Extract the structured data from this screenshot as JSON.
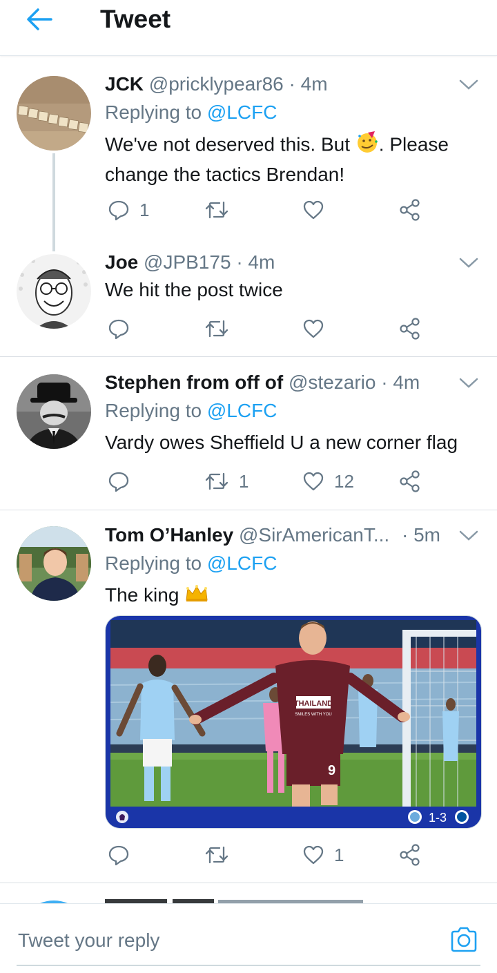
{
  "header": {
    "title": "Tweet",
    "back_icon": "arrow-left-icon"
  },
  "colors": {
    "accent": "#1da1f2",
    "secondary_text": "#657786",
    "primary_text": "#14171a",
    "card_blue": "#1a35a8"
  },
  "tweets": [
    {
      "name": "JCK",
      "handle": "@pricklypear86",
      "time": "· 4m",
      "replying_label": "Replying to",
      "replying_to": "@LCFC",
      "text_before_emoji": "We've not deserved this. But ",
      "emoji": "partying-face",
      "text_after_emoji": ". Please change the tactics Brendan!",
      "replies": "1",
      "retweets": "",
      "likes": ""
    },
    {
      "name": "Joe",
      "handle": "@JPB175",
      "time": "· 4m",
      "text": "We hit the post twice",
      "replies": "",
      "retweets": "",
      "likes": ""
    },
    {
      "name": "Stephen from off of",
      "handle": "@stezario",
      "time": "· 4m",
      "replying_label": "Replying to",
      "replying_to": "@LCFC",
      "text": "Vardy owes Sheffield U a new corner flag",
      "replies": "",
      "retweets": "1",
      "likes": "12"
    },
    {
      "name": "Tom O’Hanley",
      "handle": "@SirAmericanT...",
      "time": "· 5m",
      "replying_label": "Replying to",
      "replying_to": "@LCFC",
      "text": "The king ",
      "emoji": "crown",
      "media": {
        "score": "1-3",
        "shirt_text": "THAILAND",
        "shirt_subtext": "SMILES WITH YOU"
      },
      "replies": "",
      "retweets": "",
      "likes": "1"
    }
  ],
  "composer": {
    "placeholder": "Tweet your reply",
    "camera_icon": "camera-icon"
  }
}
